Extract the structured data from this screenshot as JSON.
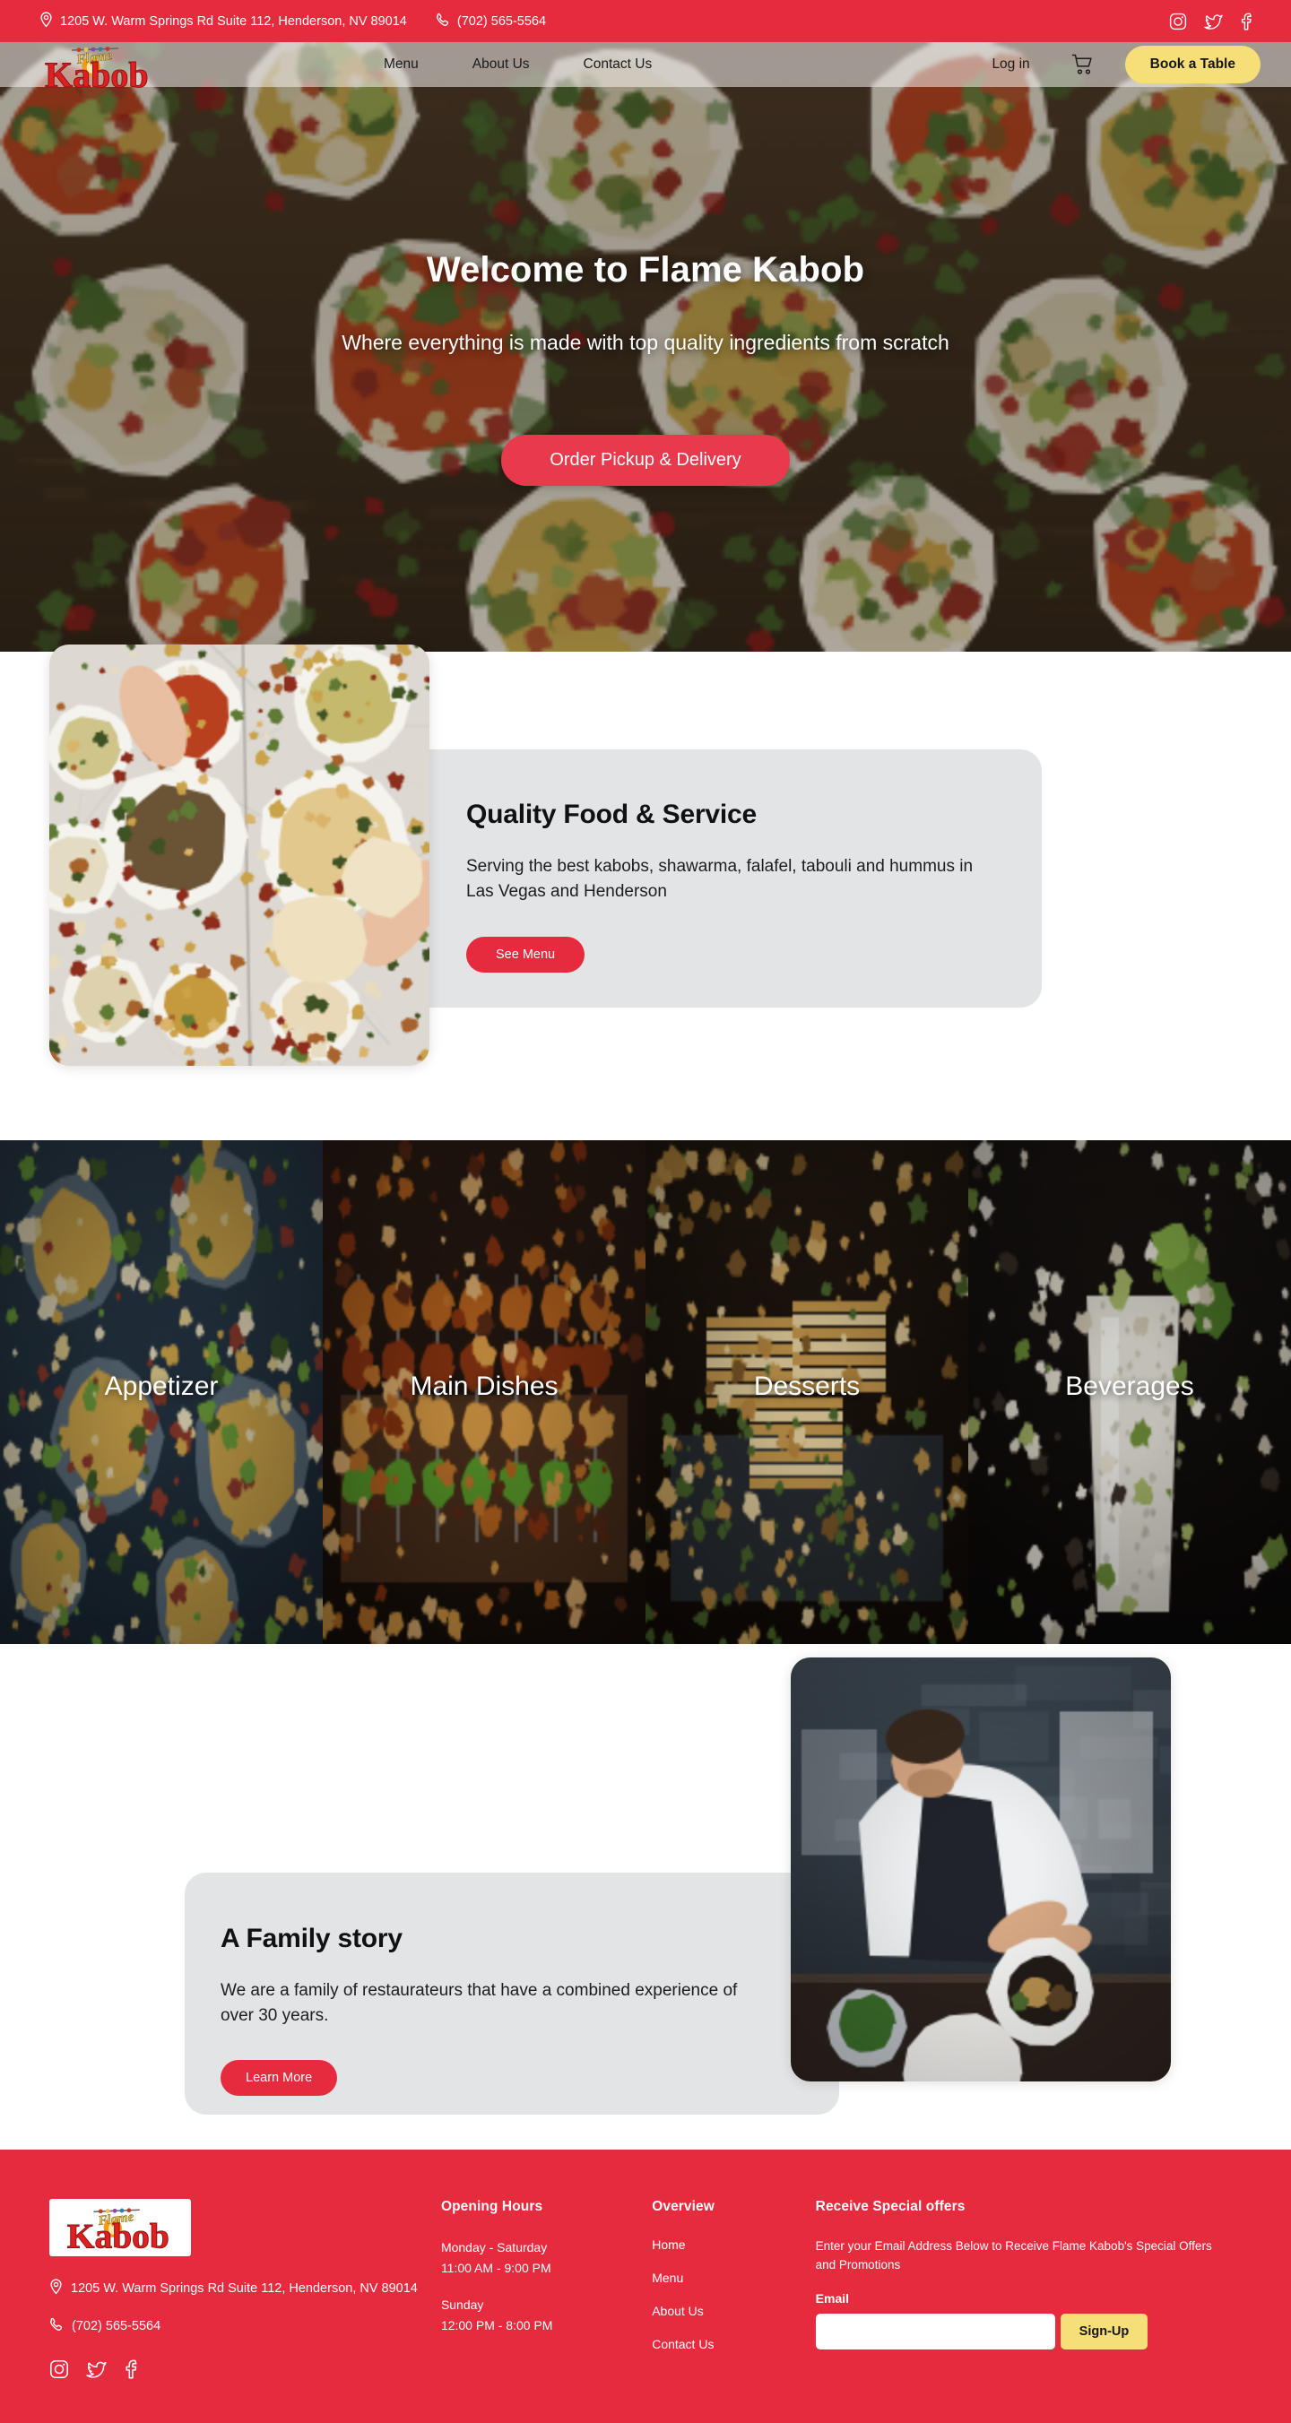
{
  "brand": {
    "name": "Flame Kabob",
    "logo_word_top": "Flame",
    "logo_word_main": "Kabob"
  },
  "colors": {
    "brand_red": "#E62B3E",
    "cta_red": "#E83A4C",
    "accent_yellow": "#F6DE78",
    "card_gray": "#E3E4E6",
    "text_dark": "#101113"
  },
  "topbar": {
    "address": "1205 W. Warm Springs Rd Suite 112, Henderson, NV 89014",
    "phone": "(702) 565-5564",
    "social": [
      {
        "name": "instagram",
        "icon": "instagram-icon"
      },
      {
        "name": "twitter",
        "icon": "twitter-icon"
      },
      {
        "name": "facebook",
        "icon": "facebook-icon"
      }
    ]
  },
  "nav": {
    "links": [
      {
        "label": "Menu"
      },
      {
        "label": "About Us"
      },
      {
        "label": "Contact Us"
      }
    ],
    "login_label": "Log in",
    "cart_icon": "shopping-cart-icon",
    "book_label": "Book a Table"
  },
  "hero": {
    "title": "Welcome to Flame Kabob",
    "subtitle": "Where everything is made with top quality ingredients from scratch",
    "cta_label": "Order Pickup & Delivery"
  },
  "quality": {
    "heading": "Quality Food & Service",
    "body": "Serving the best kabobs, shawarma, falafel, tabouli and hummus in Las Vegas and Henderson",
    "button_label": "See Menu",
    "image_alt": "mezze-spread-photo"
  },
  "categories": [
    {
      "label": "Appetizer"
    },
    {
      "label": "Main Dishes"
    },
    {
      "label": "Desserts"
    },
    {
      "label": "Beverages"
    }
  ],
  "family": {
    "heading": "A Family story",
    "body": "We are a family of restaurateurs that have a combined experience of over 30 years.",
    "button_label": "Learn More",
    "image_alt": "chef-plating-photo"
  },
  "footer": {
    "address": "1205 W. Warm Springs Rd Suite 112, Henderson, NV 89014",
    "phone": "(702) 565-5564",
    "social": [
      {
        "name": "instagram",
        "icon": "instagram-icon"
      },
      {
        "name": "twitter",
        "icon": "twitter-icon"
      },
      {
        "name": "facebook",
        "icon": "facebook-icon"
      }
    ],
    "hours": {
      "heading": "Opening Hours",
      "weekday_days": "Monday - Saturday",
      "weekday_time": "11:00 AM - 9:00 PM",
      "sunday_days": "Sunday",
      "sunday_time": "12:00 PM - 8:00 PM"
    },
    "overview": {
      "heading": "Overview",
      "links": [
        {
          "label": "Home"
        },
        {
          "label": "Menu"
        },
        {
          "label": "About Us"
        },
        {
          "label": "Contact Us"
        }
      ]
    },
    "newsletter": {
      "heading": "Receive Special offers",
      "description": "Enter your Email Address Below to Receive Flame Kabob's Special Offers and Promotions",
      "email_label": "Email",
      "email_value": "",
      "email_placeholder": "",
      "submit_label": "Sign-Up"
    }
  }
}
